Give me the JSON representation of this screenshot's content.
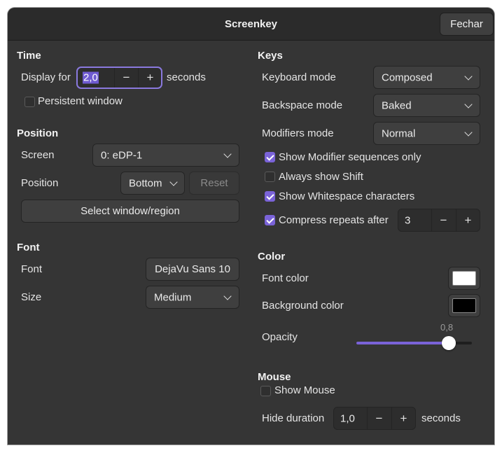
{
  "window": {
    "title": "Screenkey",
    "close_label": "Fechar"
  },
  "time": {
    "heading": "Time",
    "display_for_label": "Display for",
    "display_for_value": "2,0",
    "seconds_label": "seconds",
    "persistent_window_label": "Persistent window",
    "persistent_window_checked": false
  },
  "position": {
    "heading": "Position",
    "screen_label": "Screen",
    "screen_value": "0: eDP-1",
    "position_label": "Position",
    "position_value": "Bottom",
    "reset_label": "Reset",
    "select_region_label": "Select window/region"
  },
  "font": {
    "heading": "Font",
    "font_label": "Font",
    "font_value": "DejaVu Sans 10",
    "size_label": "Size",
    "size_value": "Medium"
  },
  "keys": {
    "heading": "Keys",
    "keyboard_mode_label": "Keyboard mode",
    "keyboard_mode_value": "Composed",
    "backspace_mode_label": "Backspace mode",
    "backspace_mode_value": "Baked",
    "modifiers_mode_label": "Modifiers mode",
    "modifiers_mode_value": "Normal",
    "show_modifier_label": "Show Modifier sequences only",
    "show_modifier_checked": true,
    "always_shift_label": "Always show Shift",
    "always_shift_checked": false,
    "show_whitespace_label": "Show Whitespace characters",
    "show_whitespace_checked": true,
    "compress_label": "Compress repeats after",
    "compress_checked": true,
    "compress_value": "3"
  },
  "color": {
    "heading": "Color",
    "font_color_label": "Font color",
    "font_color": "#ffffff",
    "background_color_label": "Background color",
    "background_color": "#000000",
    "opacity_label": "Opacity",
    "opacity_value": "0,8",
    "opacity_fraction": 0.8,
    "accent": "#7a63d8"
  },
  "mouse": {
    "heading": "Mouse",
    "show_mouse_label": "Show Mouse",
    "show_mouse_checked": false,
    "hide_duration_label": "Hide duration",
    "hide_duration_value": "1,0",
    "seconds_label": "seconds"
  },
  "glyphs": {
    "minus": "−",
    "plus": "+"
  }
}
